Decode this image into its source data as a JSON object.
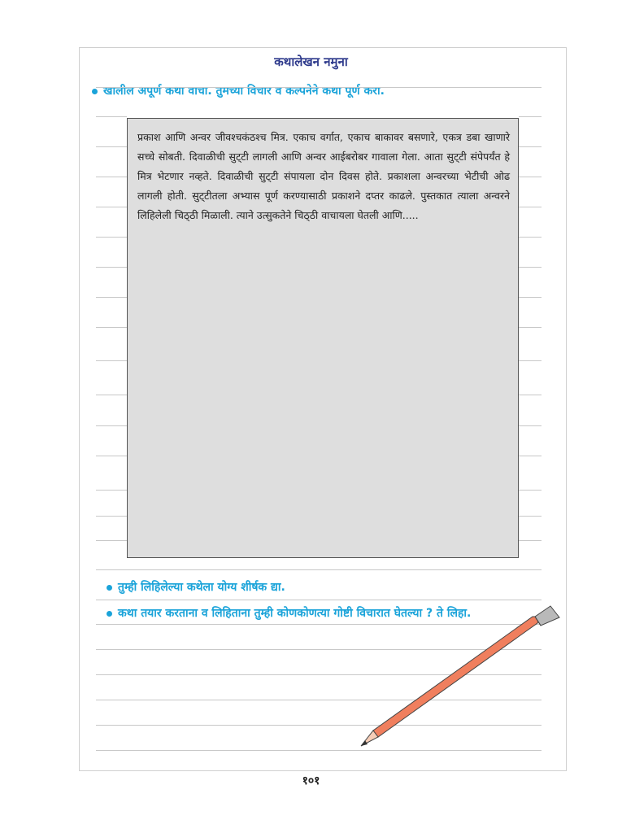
{
  "page": {
    "title": "कथालेखन नमुना",
    "instruction": "खालील अपूर्ण कथा वाचा. तुमच्या विचार व कल्पनेने कथा पूर्ण करा.",
    "story": "प्रकाश आणि अन्वर जीवश्चकंठश्च मित्र. एकाच वर्गात, एकाच बाकावर बसणारे, एकत्र डबा खाणारे सच्चे सोबती. दिवाळीची सुट्‌टी लागली आणि अन्वर आईबरोबर गावाला गेला. आता सुट्‌टी संपेपर्यंत हे मित्र भेटणार नव्हते. दिवाळीची सुट्‌टी संपायला दोन दिवस होते. प्रकाशला अन्वरच्या भेटीची ओढ लागली होती. सुट्‌टीतला अभ्यास पूर्ण करण्यासाठी प्रकाशने दप्तर काढले. पुस्तकात त्याला अन्वरने लिहिलेली चिठ्‌ठी मिळाली. त्याने उत्सुकतेने चिठ्‌ठी वाचायला घेतली आणि.....",
    "question1": "तुम्ही लिहिलेल्या कथेला योग्य शीर्षक द्या.",
    "question2": "कथा तयार करताना व लिहिताना तुम्ही कोणकोणत्या गोष्टी विचारात घेतल्या ? ते लिहा.",
    "page_number": "१०१"
  },
  "colors": {
    "title": "#2e3a8c",
    "questions": "#1aa3d9",
    "story_box": "#dedede",
    "pencil_body": "#f07f5e",
    "pencil_eraser": "#b9b9b9"
  },
  "icons": {
    "bullet": "bullet-dot-icon",
    "pencil": "pencil-icon"
  }
}
